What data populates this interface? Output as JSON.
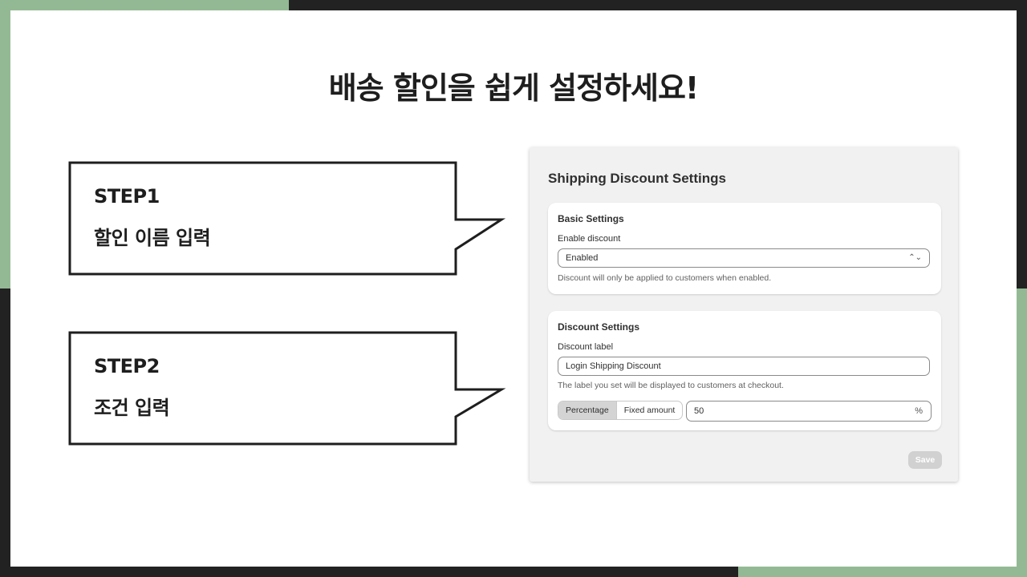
{
  "headline": "배송 할인을 쉽게 설정하세요!",
  "callouts": [
    {
      "step": "STEP1",
      "desc": "할인 이름 입력"
    },
    {
      "step": "STEP2",
      "desc": "조건 입력"
    }
  ],
  "panel": {
    "title": "Shipping Discount Settings",
    "basic": {
      "title": "Basic Settings",
      "enable_label": "Enable discount",
      "enable_value": "Enabled",
      "help": "Discount will only be applied to customers when enabled."
    },
    "discount": {
      "title": "Discount Settings",
      "label_label": "Discount label",
      "label_value": "Login Shipping Discount",
      "help": "The label you set will be displayed to customers at checkout.",
      "type_options": [
        "Percentage",
        "Fixed amount"
      ],
      "type_selected": "Percentage",
      "amount_value": "50",
      "amount_suffix": "%"
    },
    "save_label": "Save"
  },
  "colors": {
    "accent_green": "#93b994",
    "dark": "#222222"
  }
}
